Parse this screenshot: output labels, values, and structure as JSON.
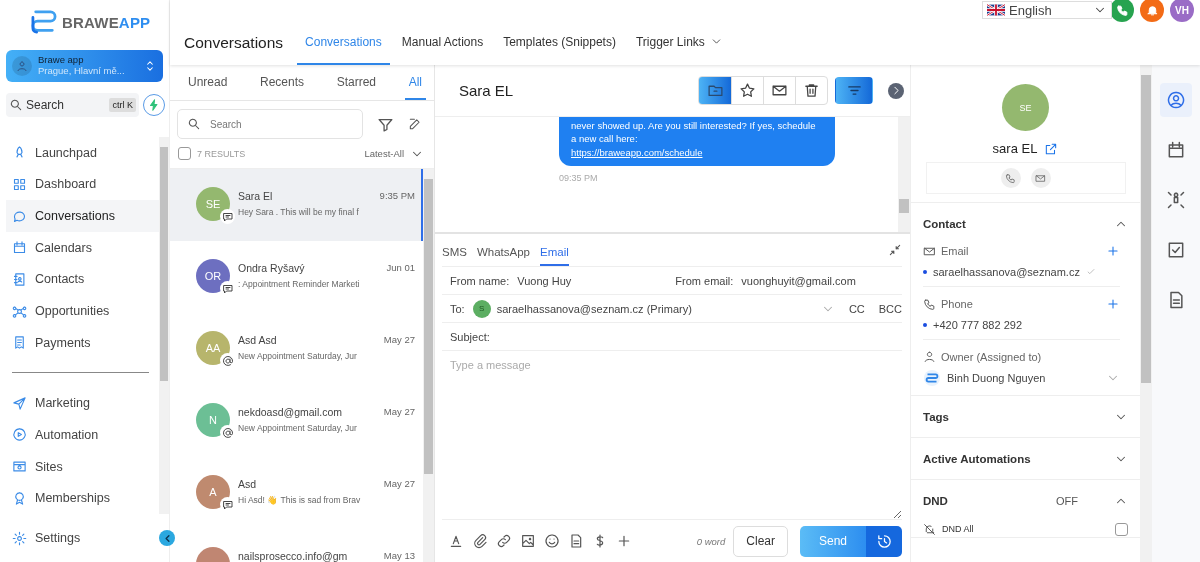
{
  "header": {
    "language": "English",
    "user_initials": "VH",
    "page_title": "Conversations",
    "tabs": [
      {
        "label": "Conversations",
        "selected": true,
        "has_menu": false
      },
      {
        "label": "Manual Actions",
        "selected": false,
        "has_menu": false
      },
      {
        "label": "Templates (Snippets)",
        "selected": false,
        "has_menu": false
      },
      {
        "label": "Trigger Links",
        "selected": false,
        "has_menu": true
      }
    ]
  },
  "sidebar": {
    "brand_first": "BRAWE",
    "brand_second": "APP",
    "account": {
      "name": "Brawe app",
      "location": "Prague, Hlavní mě..."
    },
    "search": {
      "placeholder": "Search",
      "shortcut": "ctrl K"
    },
    "nav_groups": [
      {
        "items": [
          {
            "label": "Launchpad",
            "selected": false
          },
          {
            "label": "Dashboard",
            "selected": false
          },
          {
            "label": "Conversations",
            "selected": true
          },
          {
            "label": "Calendars",
            "selected": false
          },
          {
            "label": "Contacts",
            "selected": false
          },
          {
            "label": "Opportunities",
            "selected": false
          },
          {
            "label": "Payments",
            "selected": false
          }
        ]
      },
      {
        "items": [
          {
            "label": "Marketing",
            "selected": false
          },
          {
            "label": "Automation",
            "selected": false
          },
          {
            "label": "Sites",
            "selected": false
          },
          {
            "label": "Memberships",
            "selected": false
          }
        ]
      }
    ],
    "settings": "Settings"
  },
  "conversation_list": {
    "tabs": [
      {
        "label": "Unread",
        "selected": false
      },
      {
        "label": "Recents",
        "selected": false
      },
      {
        "label": "Starred",
        "selected": false
      },
      {
        "label": "All",
        "selected": true
      }
    ],
    "search_placeholder": "Search",
    "select_all_checked": false,
    "result_count": "7 RESULTS",
    "sort": "Latest-All",
    "items": [
      {
        "initials": "SE",
        "color": "#94b86f",
        "name": "Sara El",
        "time": "9:35 PM",
        "preview": "Hey Sara . This will be my final f",
        "kind": "sms",
        "selected": true
      },
      {
        "initials": "OR",
        "color": "#6d6fc0",
        "name": "Ondra Ryšavý",
        "time": "Jun 01",
        "preview": ": Appointment Reminder Marketi",
        "kind": "sms",
        "selected": false
      },
      {
        "initials": "AA",
        "color": "#b7b56c",
        "name": "Asd Asd",
        "time": "May 27",
        "preview": "New Appointment Saturday, Jur",
        "kind": "email",
        "selected": false
      },
      {
        "initials": "N",
        "color": "#6cbf95",
        "name": "nekdoasd@gmail.com",
        "time": "May 27",
        "preview": "New Appointment Saturday, Jur",
        "kind": "email",
        "selected": false
      },
      {
        "initials": "A",
        "color": "#bf8a6f",
        "name": "Asd",
        "time": "May 27",
        "preview": "Hi Asd! 👋 This is sad from Brav",
        "kind": "sms",
        "selected": false
      },
      {
        "color": "#c08672",
        "name": "nailsprosecco.info@gm",
        "time": "May 13",
        "kind": "none",
        "selected": false
      }
    ]
  },
  "chat": {
    "contact_name": "Sara EL",
    "actions": [
      {
        "active": true
      },
      {
        "active": false
      },
      {
        "active": false
      },
      {
        "active": false
      }
    ],
    "filter_active": true,
    "message": {
      "text": "never showed up. Are you still interested? If yes, schedule a new call here:",
      "link": "https://braweapp.com/schedule",
      "time": "09:35 PM"
    },
    "composer": {
      "channels": [
        {
          "label": "SMS",
          "selected": false
        },
        {
          "label": "WhatsApp",
          "selected": false
        },
        {
          "label": "Email",
          "selected": true
        }
      ],
      "from_name_label": "From name:",
      "from_name": "Vuong Huy",
      "from_email_label": "From email:",
      "from_email": "vuonghuyit@gmail.com",
      "to_label": "To:",
      "to_initials": "S",
      "to_value": "saraelhassanova@seznam.cz (Primary)",
      "cc": "CC",
      "bcc": "BCC",
      "subject_label": "Subject:",
      "placeholder": "Type a message",
      "word_count": "0 word",
      "clear": "Clear",
      "send": "Send"
    }
  },
  "contact": {
    "initials": "SE",
    "name": "sara EL",
    "section_title": "Contact",
    "expanded": true,
    "email_label": "Email",
    "email": "saraelhassanova@seznam.cz",
    "email_verified": true,
    "phone_label": "Phone",
    "phone": "+420 777 882 292",
    "owner_label": "Owner (Assigned to)",
    "owner": "Binh Duong Nguyen",
    "sections": [
      {
        "title": "Tags",
        "expanded": false
      },
      {
        "title": "Active Automations",
        "expanded": false
      }
    ],
    "dnd": {
      "title": "DND",
      "status": "OFF",
      "expanded": true,
      "option": "DND All",
      "checked": false
    }
  },
  "rail": [
    {
      "selected": true
    },
    {
      "selected": false
    },
    {
      "selected": false
    },
    {
      "selected": false
    },
    {
      "selected": false
    }
  ]
}
